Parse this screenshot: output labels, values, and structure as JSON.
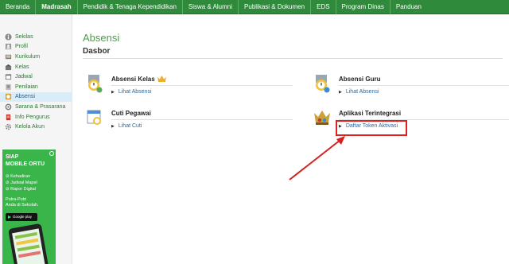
{
  "nav": {
    "items": [
      {
        "label": "Beranda"
      },
      {
        "label": "Madrasah"
      },
      {
        "label": "Pendidik & Tenaga Kependidikan"
      },
      {
        "label": "Siswa & Alumni"
      },
      {
        "label": "Publikasi & Dokumen"
      },
      {
        "label": "EDS"
      },
      {
        "label": "Program Dinas"
      },
      {
        "label": "Panduan"
      }
    ],
    "active": "Madrasah"
  },
  "sidebar": {
    "items": [
      {
        "label": "Sekilas",
        "icon": "info-icon"
      },
      {
        "label": "Profil",
        "icon": "profile-icon"
      },
      {
        "label": "Kurikulum",
        "icon": "curriculum-icon"
      },
      {
        "label": "Kelas",
        "icon": "class-icon"
      },
      {
        "label": "Jadwal",
        "icon": "schedule-icon"
      },
      {
        "label": "Penilaian",
        "icon": "grading-icon"
      },
      {
        "label": "Absensi",
        "icon": "attendance-icon"
      },
      {
        "label": "Sarana & Prasarana",
        "icon": "facilities-icon"
      },
      {
        "label": "Info Pengurus",
        "icon": "board-info-icon"
      },
      {
        "label": "Kelola Akun",
        "icon": "account-icon"
      }
    ],
    "active": "Absensi"
  },
  "ad": {
    "title_line1": "SIAP",
    "title_line2": "MOBILE ORTU",
    "features": [
      "⊘ Kehadiran",
      "⊘ Jadwal Mapel",
      "⊘ Rapor Digital"
    ],
    "desc_line1": "Putra-Putri",
    "desc_line2": "Anda di Sekolah.",
    "store_label": "Google play"
  },
  "main": {
    "title": "Absensi",
    "subtitle": "Dasbor",
    "cards": [
      {
        "title": "Absensi Kelas",
        "link": "Lihat Absensi",
        "icon": "class-attendance-icon"
      },
      {
        "title": "Absensi Guru",
        "link": "Lihat Absensi",
        "icon": "teacher-attendance-icon"
      },
      {
        "title": "Cuti Pegawai",
        "link": "Lihat Cuti",
        "icon": "leave-icon"
      },
      {
        "title": "Aplikasi Terintegrasi",
        "link": "Daftar Token Aktivasi",
        "icon": "integrated-app-icon"
      }
    ]
  },
  "colors": {
    "nav_bg": "#2f8b3b",
    "accent_green": "#4a9e4a",
    "link_blue": "#2c6aa0",
    "highlight_red": "#e02020",
    "active_sidebar_bg": "#d9ecf7"
  }
}
